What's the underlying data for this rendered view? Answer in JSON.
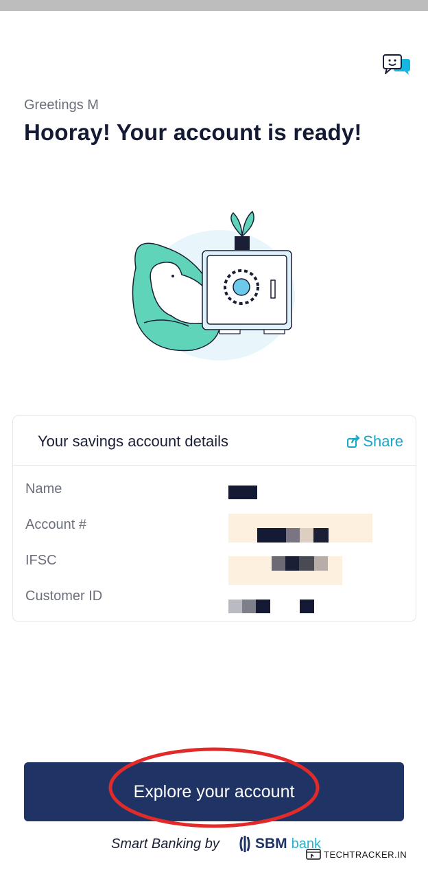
{
  "header": {
    "greeting": "Greetings M",
    "title": "Hooray! Your account is ready!"
  },
  "icons": {
    "chat": "chat-support-icon",
    "share": "share-icon",
    "illustration": "dog-beanbag-safe-illustration"
  },
  "account_card": {
    "title": "Your savings account details",
    "share_label": "Share",
    "rows": [
      {
        "label": "Name",
        "value": ""
      },
      {
        "label": "Account #",
        "value": ""
      },
      {
        "label": "IFSC",
        "value": ""
      },
      {
        "label": "Customer ID",
        "value": ""
      }
    ]
  },
  "cta": {
    "label": "Explore your account"
  },
  "footer": {
    "prefix": "Smart Banking by",
    "brand": "SBM",
    "brand_suffix": "bank"
  },
  "watermark": "TECHTRACKER.IN",
  "colors": {
    "primary": "#1f3464",
    "accent": "#17a6c8",
    "annotation": "#e12a2a"
  }
}
